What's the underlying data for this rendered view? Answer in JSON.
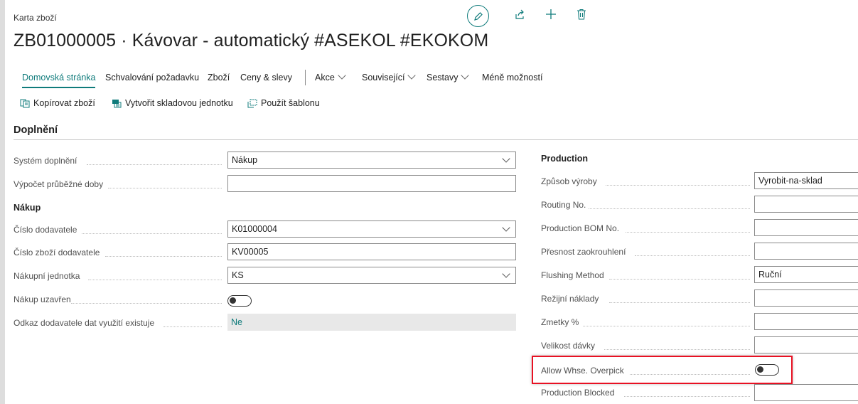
{
  "page": {
    "breadcrumb": "Karta zboží",
    "title": "ZB01000005 · Kávovar - automatický #ASEKOL #EKOKOM"
  },
  "nav": {
    "items": [
      {
        "label": "Domovská stránka",
        "active": true
      },
      {
        "label": "Schvalování požadavku"
      },
      {
        "label": "Zboží"
      },
      {
        "label": "Ceny & slevy"
      },
      {
        "label": "Akce",
        "dropdown": true
      },
      {
        "label": "Související",
        "dropdown": true
      },
      {
        "label": "Sestavy",
        "dropdown": true
      },
      {
        "label": "Méně možností"
      }
    ]
  },
  "toolbar": {
    "copy_item": "Kopírovat zboží",
    "create_sku": "Vytvořit skladovou jednotku",
    "apply_template": "Použít šablonu"
  },
  "section": {
    "title": "Doplnění"
  },
  "left": {
    "replenishment_system": {
      "label": "Systém doplnění",
      "value": "Nákup"
    },
    "lead_time_calc": {
      "label": "Výpočet průběžné doby",
      "value": ""
    },
    "purchase_heading": "Nákup",
    "vendor_no": {
      "label": "Číslo dodavatele",
      "value": "K01000004"
    },
    "vendor_item_no": {
      "label": "Číslo zboží dodavatele",
      "value": "KV00005"
    },
    "purch_unit": {
      "label": "Nákupní jednotka",
      "value": "KS"
    },
    "purchase_blocked": {
      "label": "Nákup uzavřen",
      "on": false
    },
    "vendor_ref": {
      "label": "Odkaz dodavatele dat využití existuje",
      "value": "Ne"
    }
  },
  "right": {
    "production_heading": "Production",
    "manufacturing_policy": {
      "label": "Způsob výroby",
      "value": "Vyrobit-na-sklad"
    },
    "routing_no": {
      "label": "Routing No.",
      "value": ""
    },
    "production_bom_no": {
      "label": "Production BOM No.",
      "value": ""
    },
    "rounding_precision": {
      "label": "Přesnost zaokrouhlení",
      "value": ""
    },
    "flushing_method": {
      "label": "Flushing Method",
      "value": "Ruční"
    },
    "overhead_cost": {
      "label": "Režijní náklady",
      "value": ""
    },
    "scrap_pct": {
      "label": "Zmetky %",
      "value": ""
    },
    "lot_size": {
      "label": "Velikost dávky",
      "value": ""
    },
    "allow_overpick": {
      "label": "Allow Whse. Overpick",
      "on": false
    },
    "production_blocked": {
      "label": "Production Blocked",
      "value": ""
    }
  },
  "colors": {
    "accent": "#0f7b7b",
    "highlight": "#e81123"
  }
}
